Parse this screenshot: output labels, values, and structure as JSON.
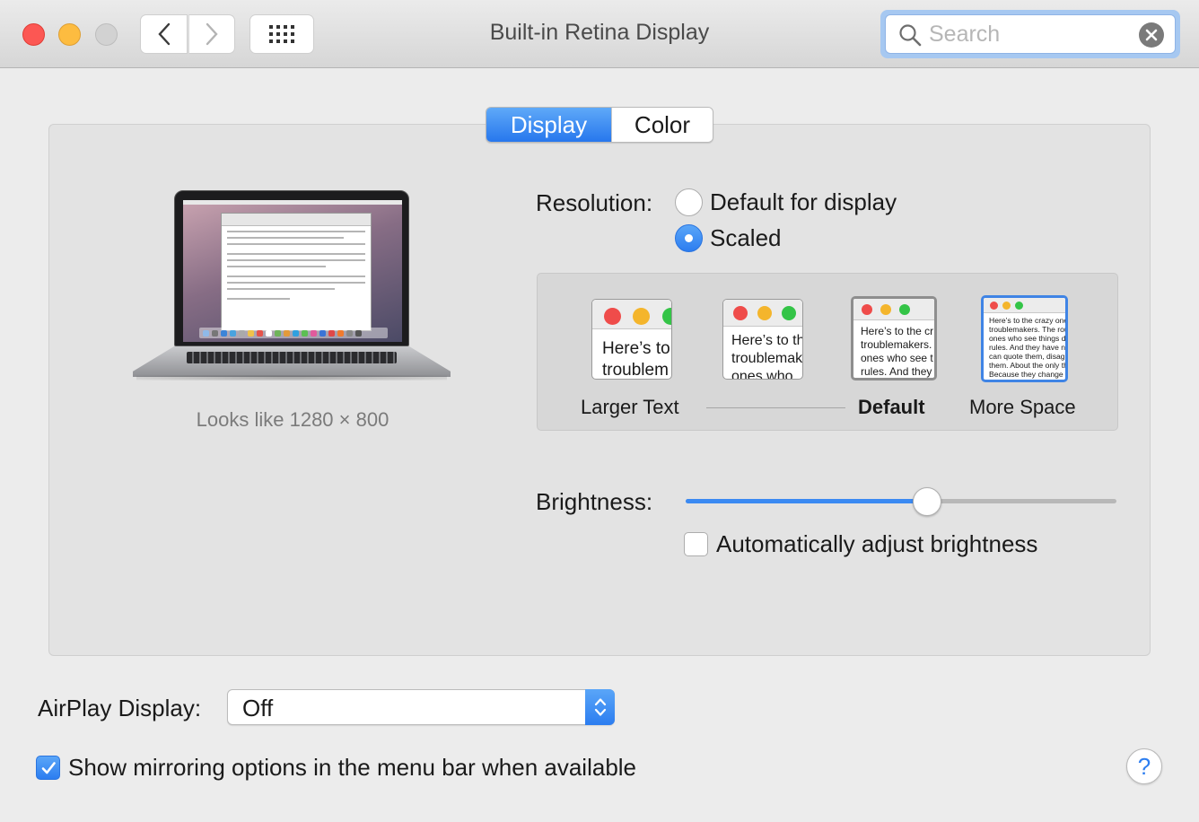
{
  "window": {
    "title": "Built-in Retina Display"
  },
  "search": {
    "placeholder": "Search",
    "value": ""
  },
  "tabs": [
    {
      "label": "Display",
      "selected": true
    },
    {
      "label": "Color",
      "selected": false
    }
  ],
  "preview": {
    "looks_like": "Looks like 1280 × 800"
  },
  "resolution": {
    "label": "Resolution:",
    "options": [
      {
        "label": "Default for display",
        "selected": false
      },
      {
        "label": "Scaled",
        "selected": true
      }
    ]
  },
  "scaled_options": [
    {
      "label": "Larger Text",
      "sample": "Here’s to\ntroublem",
      "selected": false
    },
    {
      "label": "",
      "sample": "Here’s to th\ntroublemak\nones who",
      "selected": false
    },
    {
      "label": "Default",
      "sample": "Here’s to the cr\ntroublemakers.\nones who see t\nrules. And they",
      "selected": true
    },
    {
      "label": "More Space",
      "sample": "Here’s to the crazy one\ntroublemakers. The rou\nones who see things di\nrules. And they have no\ncan quote them, disagr\nthem. About the only th\nBecause they change t",
      "selected": false
    }
  ],
  "brightness": {
    "label": "Brightness:",
    "level": 0.56,
    "auto_label": "Automatically adjust brightness",
    "auto_checked": false
  },
  "airplay": {
    "label": "AirPlay Display:",
    "value": "Off"
  },
  "mirroring": {
    "label": "Show mirroring options in the menu bar when available",
    "checked": true
  },
  "help": {
    "label": "?"
  },
  "colors": {
    "accent": "#2c7df0",
    "close": "#fc5753",
    "minimize": "#fdbc40",
    "zoom_disabled": "#d2d2d2"
  }
}
